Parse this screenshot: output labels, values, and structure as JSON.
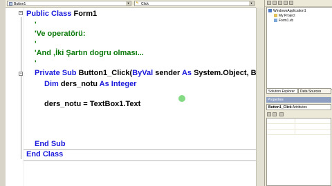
{
  "object_combo": {
    "value": "Button1"
  },
  "event_combo": {
    "value": "Click"
  },
  "code": {
    "line1": {
      "kw1": "Public Class",
      "rest": " Form1"
    },
    "line2": "'",
    "line3": "'Ve operatörü:",
    "line4": "'",
    "line5": "'And ,İki Şartın dogru olması...",
    "line6": "'",
    "line7": {
      "kw1": "Private Sub",
      "mid1": " Button1_Click(",
      "kw2": "ByVal",
      "mid2": " sender ",
      "kw3": "As",
      "rest": " System.Object, B"
    },
    "line8": {
      "kw1": "Dim",
      "mid1": " ders_notu ",
      "kw2": "As Integer"
    },
    "line9": "ders_notu = TextBox1.Text",
    "line10": "End Sub",
    "line11": "End Class"
  },
  "solution_explorer": {
    "items": [
      "WindowsApplication1",
      "My Project",
      "Form1.vb"
    ]
  },
  "tabs": {
    "solution": "Solution Explorer",
    "data": "Data Sources"
  },
  "properties": {
    "title": "Properties",
    "object": "Button1_Click",
    "object_type": "Attributes"
  },
  "colors": {
    "keyword": "#1a1adc",
    "comment": "#0a7a0a",
    "cursor": "#6fd56f"
  }
}
